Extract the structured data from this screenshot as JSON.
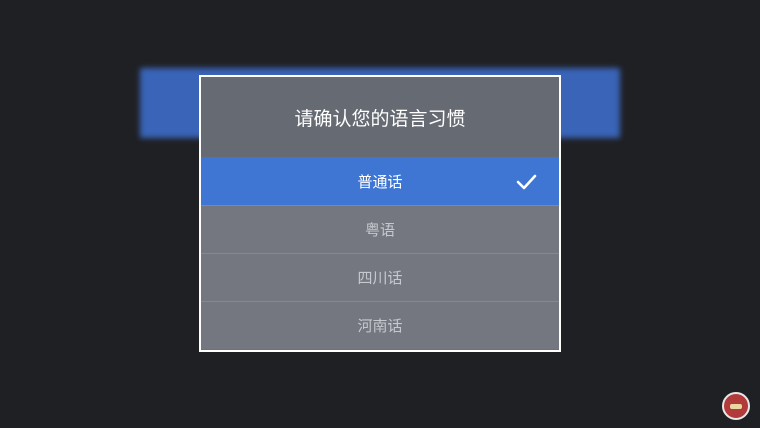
{
  "background": {
    "title": "",
    "bar_left": "",
    "bar_right": "",
    "rows": []
  },
  "dialog": {
    "title": "请确认您的语言习惯",
    "options": [
      {
        "label": "普通话",
        "selected": true
      },
      {
        "label": "粤语",
        "selected": false
      },
      {
        "label": "四川话",
        "selected": false
      },
      {
        "label": "河南话",
        "selected": false
      }
    ]
  },
  "colors": {
    "accent": "#3f76d4",
    "dialog_bg": "#6e7179",
    "page_bg": "#1f2024"
  },
  "icons": {
    "check": "check-icon",
    "logo": "watermark-logo"
  }
}
